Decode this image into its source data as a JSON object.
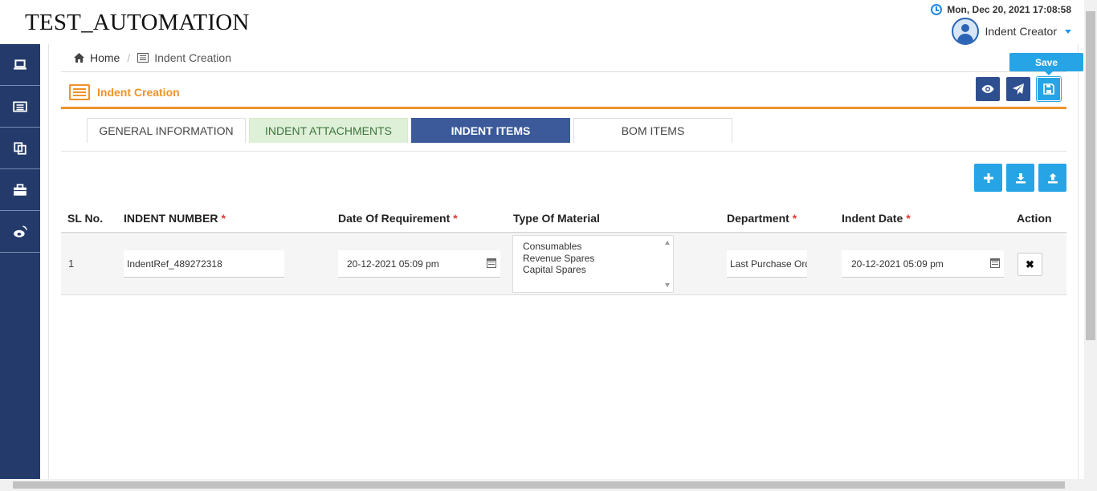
{
  "app": {
    "title": "TEST_AUTOMATION"
  },
  "header": {
    "datetime": "Mon, Dec 20, 2021 17:08:58",
    "user_name": "Indent Creator"
  },
  "breadcrumb": {
    "home": "Home",
    "current": "Indent Creation"
  },
  "page": {
    "title": "Indent Creation"
  },
  "toolbar": {
    "save_tooltip": "Save"
  },
  "sidebar": {
    "items": [
      "laptop-icon",
      "list-icon",
      "copy-icon",
      "briefcase-icon",
      "weibo-icon"
    ]
  },
  "tabs": [
    "GENERAL INFORMATION",
    "INDENT ATTACHMENTS",
    "INDENT ITEMS",
    "BOM ITEMS"
  ],
  "table": {
    "columns": [
      "SL No.",
      "INDENT NUMBER",
      "Date Of Requirement",
      "Type Of Material",
      "Department",
      "Indent Date",
      "Action"
    ],
    "required_marker": "*",
    "rows": [
      {
        "sl": "1",
        "indent_number": "IndentRef_489272318",
        "date_of_requirement": "20-12-2021 05:09 pm",
        "material_options": [
          "Consumables",
          "Revenue Spares",
          "Capital Spares"
        ],
        "department": "Last Purchase Ord",
        "indent_date": "20-12-2021 05:09 pm",
        "action": "✖"
      }
    ]
  },
  "colors": {
    "sidebar": "#233a6b",
    "accent": "#f0922b",
    "primary": "#26a4e6",
    "active_tab": "#3c5a99"
  }
}
